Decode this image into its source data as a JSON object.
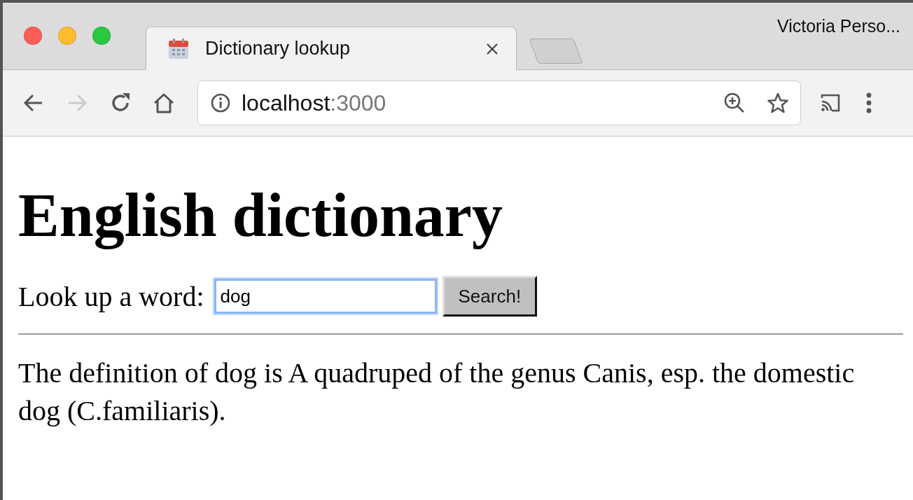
{
  "browser": {
    "tab_title": "Dictionary lookup",
    "profile": "Victoria Perso...",
    "forward_disabled": true,
    "url_host": "localhost",
    "url_port": ":3000"
  },
  "page": {
    "heading": "English dictionary",
    "label": "Look up a word:",
    "field_value": "dog",
    "field_focused": true,
    "button": "Search!",
    "result": "The definition of dog is A quadruped of the genus Canis, esp. the domestic dog (C.familiaris)."
  }
}
